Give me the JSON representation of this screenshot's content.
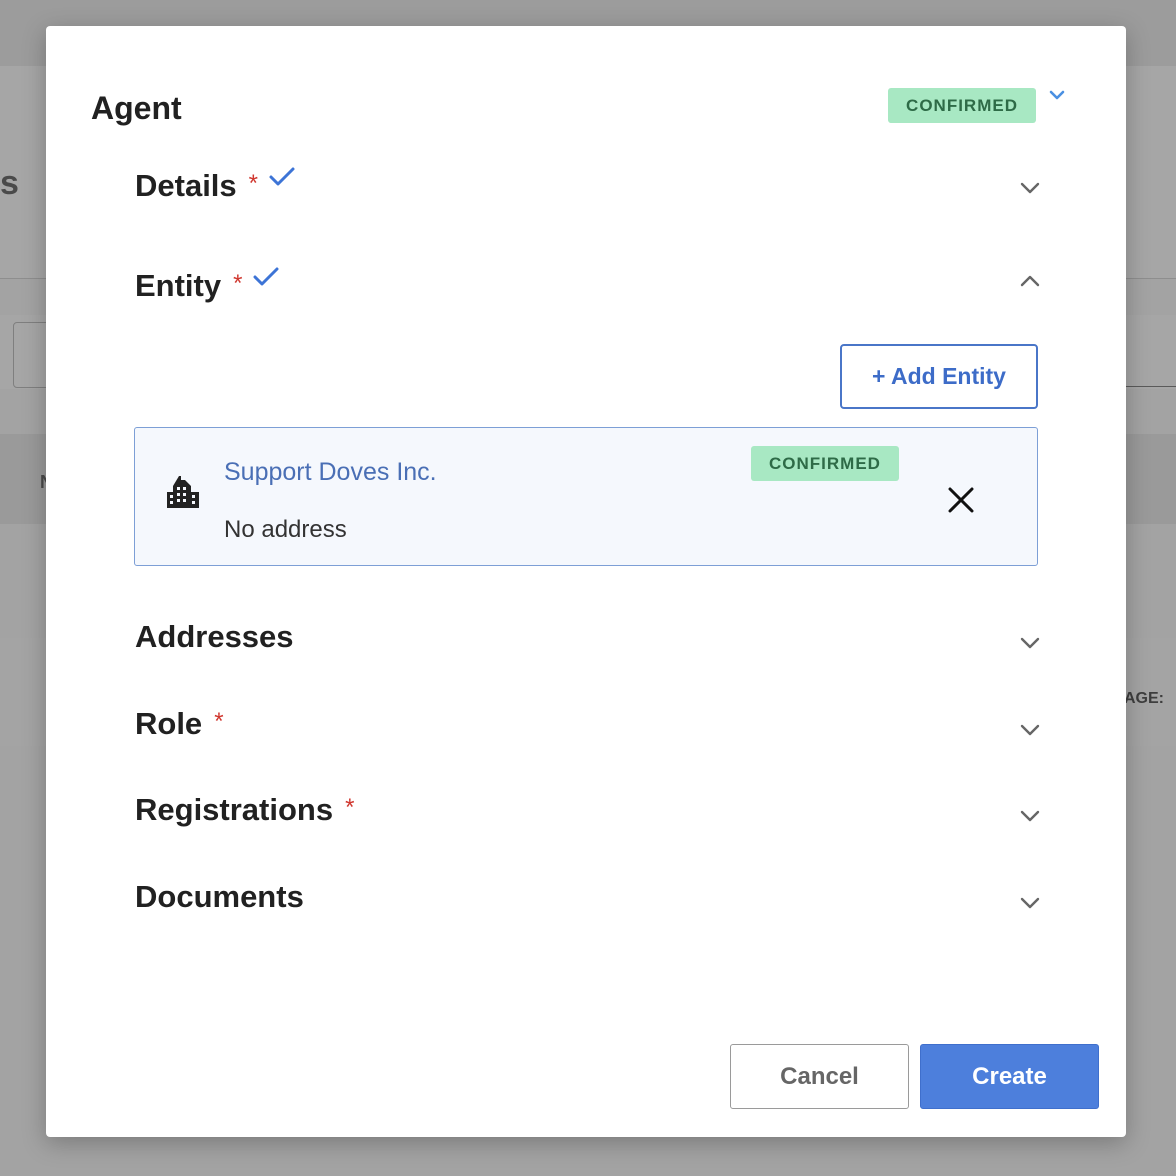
{
  "background": {
    "partial_heading": "s",
    "partial_column": "N",
    "partial_label": "AGE:"
  },
  "modal": {
    "title": "Agent",
    "status_badge": "CONFIRMED"
  },
  "sections": {
    "details": {
      "title": "Details",
      "required": "*"
    },
    "entity": {
      "title": "Entity",
      "required": "*"
    },
    "addresses": {
      "title": "Addresses"
    },
    "role": {
      "title": "Role",
      "required": "*"
    },
    "registrations": {
      "title": "Registrations",
      "required": "*"
    },
    "documents": {
      "title": "Documents"
    }
  },
  "entity_panel": {
    "add_button_label": "+ Add Entity",
    "card": {
      "name": "Support Doves Inc.",
      "address": "No address",
      "status_badge": "CONFIRMED"
    }
  },
  "footer": {
    "cancel_label": "Cancel",
    "create_label": "Create"
  },
  "colors": {
    "accent": "#4d7fdc",
    "badge_bg": "#a8e8c3",
    "badge_text": "#2e6b47",
    "required": "#d0372f"
  }
}
